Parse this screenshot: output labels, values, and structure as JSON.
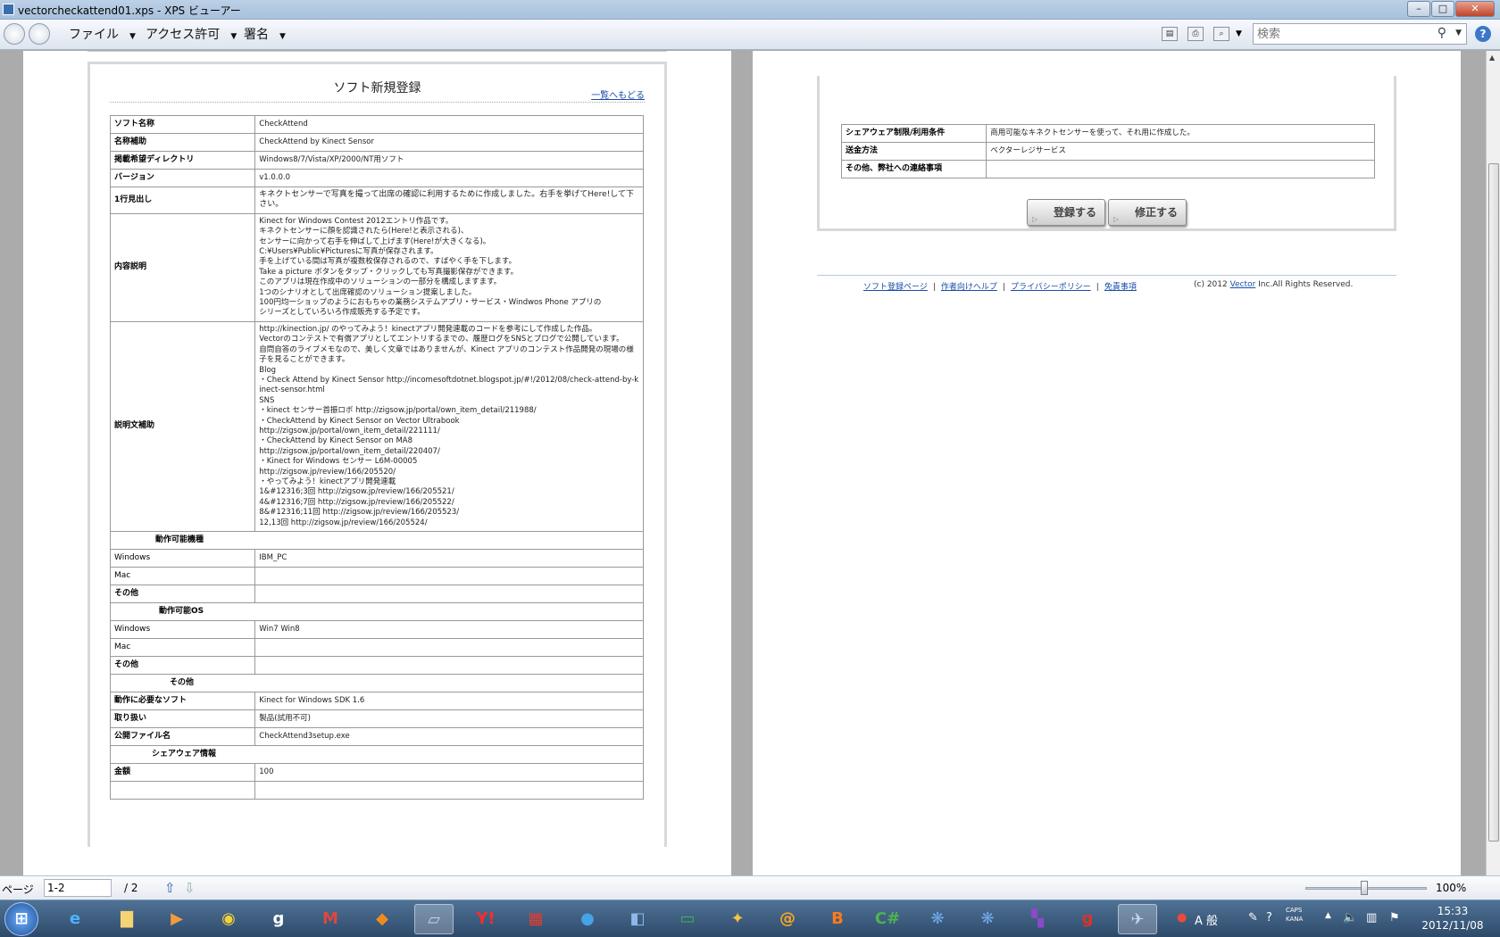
{
  "window": {
    "title": "vectorcheckattend01.xps - XPS ビューアー",
    "min": "–",
    "max": "□",
    "close": "✕"
  },
  "menu": {
    "file": "ファイル",
    "permissions": "アクセス許可",
    "signature": "署名"
  },
  "search": {
    "placeholder": "検索"
  },
  "page1": {
    "title": "ソフト新規登録",
    "back_link": "一覧へもどる",
    "rows": [
      {
        "label": "ソフト名称",
        "value": "CheckAttend"
      },
      {
        "label": "名称補助",
        "value": "CheckAttend by Kinect Sensor"
      },
      {
        "label": "掲載希望ディレクトリ",
        "value": "Windows8/7/Vista/XP/2000/NT用ソフト"
      },
      {
        "label": "バージョン",
        "value": "v1.0.0.0"
      },
      {
        "label": "1行見出し",
        "value": "キネクトセンサーで写真を撮って出席の確認に利用するために作成しました。右手を挙げてHere!して下さい。"
      },
      {
        "label": "内容説明",
        "value": "Kinect for Windows Contest 2012エントリ作品です。\nキネクトセンサーに顔を認識されたら(Here!と表示される)、\nセンサーに向かって右手を伸ばして上げます(Here!が大きくなる)。\nC:¥Users¥Public¥Picturesに写真が保存されます。\n手を上げている間は写真が複数枚保存されるので、すばやく手を下します。\nTake a picture ボタンをタップ・クリックしても写真撮影保存ができます。\nこのアプリは現在作成中のソリューションの一部分を構成しますます。\n1つのシナリオとして出席確認のソリューション提案しました。\n100円均一ショップのようにおもちゃの業務システムアプリ・サービス・Windwos Phone アプリの\nシリーズとしていろいろ作成販売する予定です。"
      },
      {
        "label": "説明文補助",
        "value": "http://kinection.jp/ のやってみよう！kinectアプリ開発連載のコードを参考にして作成した作品。\nVectorのコンテストで有償アプリとしてエントリするまでの、履歴ログをSNSとブログで公開しています。\n自問自答のライブメモなので、美しく文章ではありませんが、Kinect アプリのコンテスト作品開発の現場の様子を見ることができます。\nBlog\n・Check Attend by Kinect Sensor http://incomesoftdotnet.blogspot.jp/#!/2012/08/check-attend-by-kinect-sensor.html\nSNS\n・kinect センサー首振ロボ  http://zigsow.jp/portal/own_item_detail/211988/\n・CheckAttend by Kinect Sensor on Vector Ultrabook\nhttp://zigsow.jp/portal/own_item_detail/221111/\n・CheckAttend by Kinect Sensor on MA8\nhttp://zigsow.jp/portal/own_item_detail/220407/\n・Kinect for Windows センサー L6M-00005\nhttp://zigsow.jp/review/166/205520/\n・やってみよう！kinectアプリ開発連載\n1&#12316;3回 http://zigsow.jp/review/166/205521/\n4&#12316;7回 http://zigsow.jp/review/166/205522/\n8&#12316;11回 http://zigsow.jp/review/166/205523/\n12,13回 http://zigsow.jp/review/166/205524/"
      }
    ],
    "section_devices": "動作可能機種",
    "device_rows": [
      {
        "label": "Windows",
        "value": "IBM_PC"
      },
      {
        "label": "Mac",
        "value": ""
      },
      {
        "label": "その他",
        "value": ""
      }
    ],
    "section_os": "動作可能OS",
    "os_rows": [
      {
        "label": "Windows",
        "value": "Win7  Win8"
      },
      {
        "label": "Mac",
        "value": ""
      },
      {
        "label": "その他",
        "value": ""
      }
    ],
    "section_other": "その他",
    "other_rows": [
      {
        "label": "動作に必要なソフト",
        "value": "Kinect for Windows SDK 1.6"
      },
      {
        "label": "取り扱い",
        "value": "製品(試用不可)"
      },
      {
        "label": "公開ファイル名",
        "value": "CheckAttend3setup.exe"
      }
    ],
    "section_shareware": "シェアウェア情報",
    "shareware_rows": [
      {
        "label": "金額",
        "value": "100"
      },
      {
        "label": "",
        "value": ""
      }
    ]
  },
  "page2": {
    "rows": [
      {
        "label": "シェアウェア制限/利用条件",
        "value": "商用可能なキネクトセンサーを使って、それ用に作成した。"
      },
      {
        "label": "送金方法",
        "value": "ベクターレジサービス"
      },
      {
        "label": "その他、弊社への連絡事項",
        "value": ""
      }
    ],
    "register_button": "登録する",
    "edit_button": "修正する",
    "footer": {
      "link1": "ソフト登録ページ",
      "link2": "作者向けヘルプ",
      "link3": "プライバシーポリシー",
      "link4": "免責事項",
      "sep": "|",
      "copyright_prefix": "(c) 2012 ",
      "copyright_link": "Vector",
      "copyright_suffix": " Inc.All Rights Reserved."
    }
  },
  "status": {
    "page_label": "ページ",
    "page_value": "1-2",
    "page_total": "/ 2",
    "zoom": "100%"
  },
  "tray": {
    "caps": "CAPS",
    "kana": "KANA",
    "ime": "A 般",
    "time": "15:33",
    "date": "2012/11/08"
  },
  "taskbar_icons": [
    "windows-start",
    "internet-explorer",
    "explorer",
    "media-player",
    "chrome",
    "google",
    "gmail",
    "office",
    "xps-viewer",
    "yahoo",
    "app-store",
    "network",
    "visual-studio",
    "excel",
    "maps",
    "mail",
    "blogger",
    "csharp",
    "paw1",
    "paw2",
    "onenote",
    "gmail-g",
    "messenger"
  ],
  "colors": {
    "link": "#1a4ea8",
    "taskbar": "#2e4a6a"
  }
}
